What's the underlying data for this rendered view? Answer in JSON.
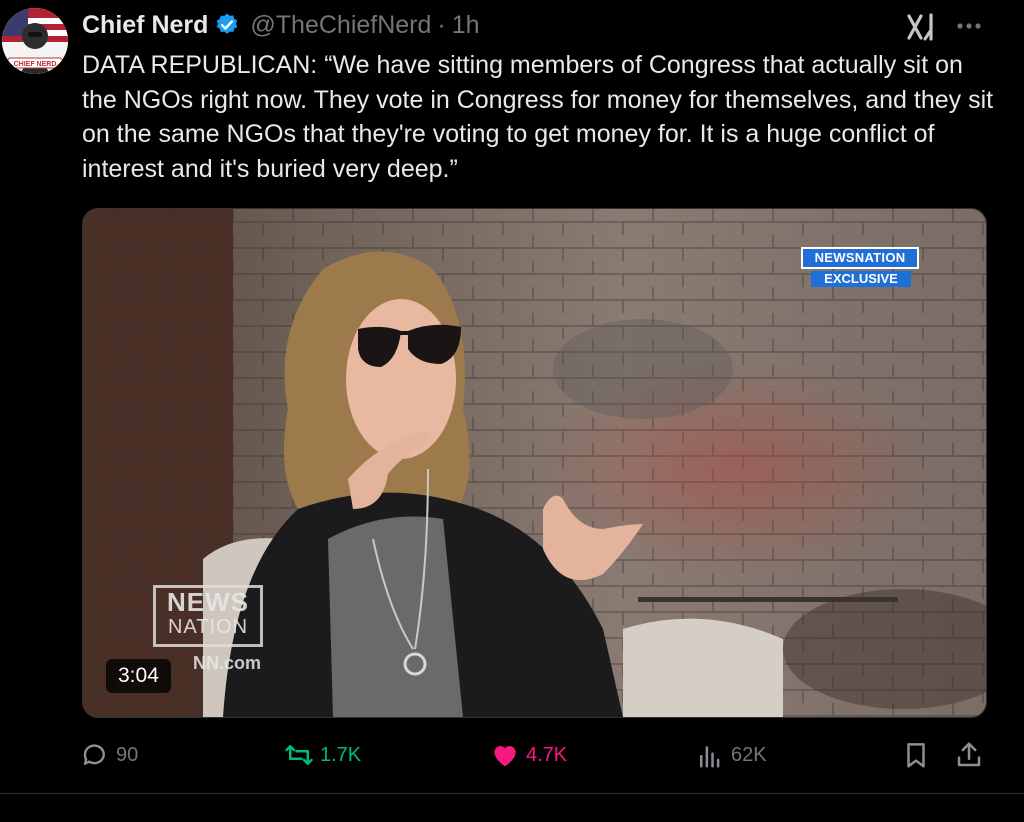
{
  "tweet": {
    "display_name": "Chief Nerd",
    "handle": "@TheChiefNerd",
    "separator": "·",
    "time": "1h",
    "text": "DATA REPUBLICAN: “We have sitting members of Congress that actually sit on the NGOs right now. They vote in Congress for money for themselves, and they sit on the same NGOs that they're voting to get money for. It is a huge conflict of interest and it's buried very deep.”",
    "avatar_label": "CHIEF NERD"
  },
  "video": {
    "duration": "3:04",
    "badge_top": "NEWSNATION",
    "badge_bottom": "EXCLUSIVE",
    "logo_line1": "NEWS",
    "logo_line2": "NATION",
    "watermark": "NN.com"
  },
  "actions": {
    "replies": "90",
    "reposts": "1.7K",
    "likes": "4.7K",
    "views": "62K"
  },
  "colors": {
    "background": "#000000",
    "text": "#e7e9ea",
    "muted": "#71767b",
    "verified": "#1d9bf0",
    "repost": "#00ba7c",
    "like": "#f91880",
    "newsnation": "#1f6fd8"
  },
  "icons": [
    "verified-badge-icon",
    "grok-icon",
    "more-icon",
    "reply-icon",
    "repost-icon",
    "like-icon",
    "views-icon",
    "bookmark-icon",
    "share-icon"
  ]
}
